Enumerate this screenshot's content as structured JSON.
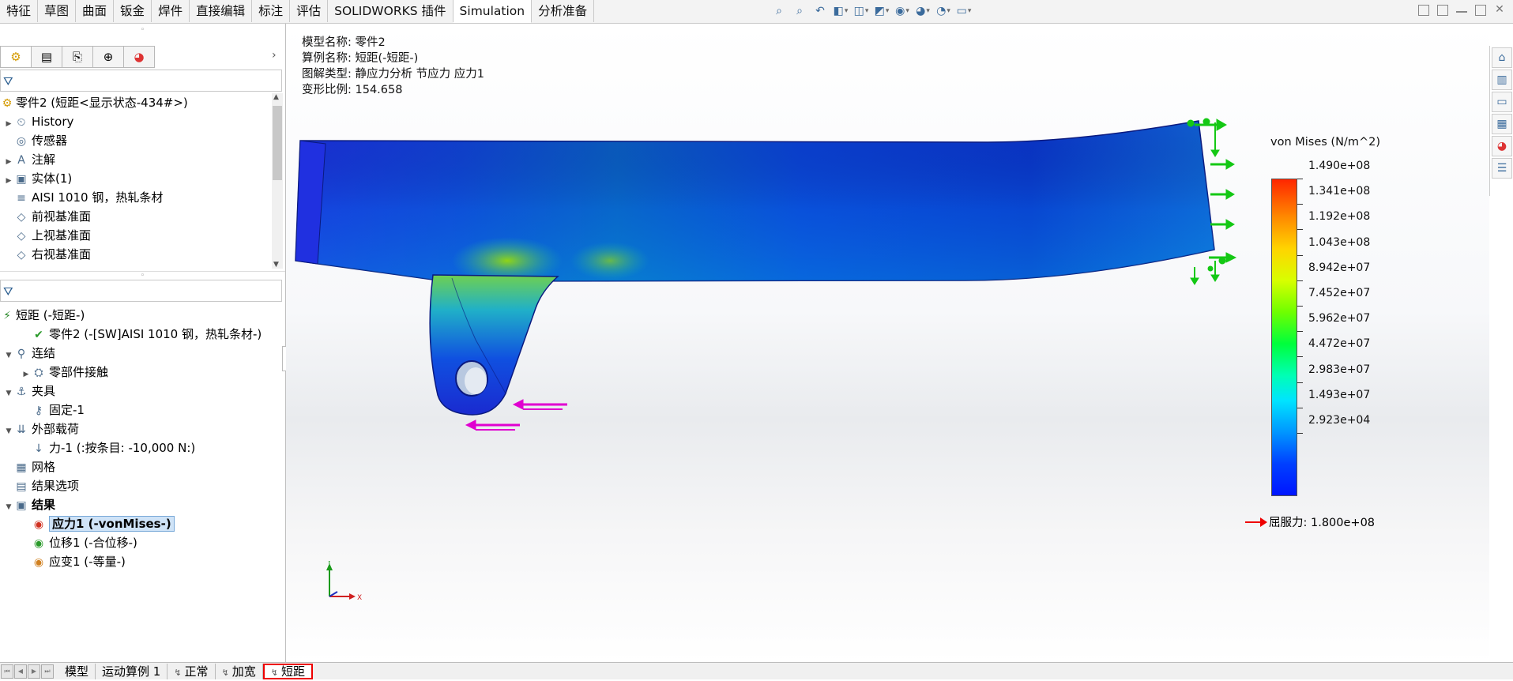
{
  "command_tabs": [
    "特征",
    "草图",
    "曲面",
    "钣金",
    "焊件",
    "直接编辑",
    "标注",
    "评估",
    "SOLIDWORKS 插件",
    "Simulation",
    "分析准备"
  ],
  "active_tab": "Simulation",
  "view_tool_icons": [
    "zoom-to-fit-icon",
    "zoom-area-icon",
    "previous-view-icon",
    "section-view-icon",
    "view-orientation-icon",
    "display-style-icon",
    "hide-show-icon",
    "edit-appearance-icon",
    "apply-scene-icon",
    "view-settings-icon"
  ],
  "feature_tree": {
    "root": "零件2  (短距<显示状态-434#>)",
    "items": [
      {
        "label": "History",
        "icon": "history-icon",
        "expandable": true
      },
      {
        "label": "传感器",
        "icon": "sensor-icon",
        "expandable": false
      },
      {
        "label": "注解",
        "icon": "annotation-icon",
        "expandable": true
      },
      {
        "label": "实体(1)",
        "icon": "solid-body-icon",
        "expandable": true
      },
      {
        "label": "AISI 1010 钢，热轧条材",
        "icon": "material-icon",
        "expandable": false
      },
      {
        "label": "前视基准面",
        "icon": "plane-icon",
        "expandable": false
      },
      {
        "label": "上视基准面",
        "icon": "plane-icon",
        "expandable": false
      },
      {
        "label": "右视基准面",
        "icon": "plane-icon",
        "expandable": false
      }
    ]
  },
  "sim_tree": {
    "root": "短距 (-短距-)",
    "items": [
      {
        "label": "零件2 (-[SW]AISI 1010 钢，热轧条材-)",
        "level": 1,
        "icon": "part-check-icon",
        "expandable": false
      },
      {
        "label": "连结",
        "level": 0,
        "icon": "connection-icon",
        "expandable": true
      },
      {
        "label": "零部件接触",
        "level": 1,
        "icon": "component-contact-icon",
        "expandable": true
      },
      {
        "label": "夹具",
        "level": 0,
        "icon": "fixture-icon",
        "expandable": true
      },
      {
        "label": "固定-1",
        "level": 1,
        "icon": "fixed-geometry-icon",
        "expandable": false
      },
      {
        "label": "外部载荷",
        "level": 0,
        "icon": "external-load-icon",
        "expandable": true
      },
      {
        "label": "力-1 (:按条目: -10,000 N:)",
        "level": 1,
        "icon": "force-arrow-icon",
        "expandable": false
      },
      {
        "label": "网格",
        "level": 0,
        "icon": "mesh-icon",
        "expandable": false
      },
      {
        "label": "结果选项",
        "level": 0,
        "icon": "result-options-icon",
        "expandable": false
      },
      {
        "label": "结果",
        "level": 0,
        "icon": "results-folder-icon",
        "expandable": true,
        "bold": true
      },
      {
        "label": "应力1 (-vonMises-)",
        "level": 1,
        "icon": "stress-plot-icon",
        "expandable": false,
        "selected": true
      },
      {
        "label": "位移1 (-合位移-)",
        "level": 1,
        "icon": "displacement-plot-icon",
        "expandable": false
      },
      {
        "label": "应变1 (-等量-)",
        "level": 1,
        "icon": "strain-plot-icon",
        "expandable": false
      }
    ]
  },
  "plot_info": {
    "lines": [
      "模型名称: 零件2",
      "算例名称: 短距(-短距-)",
      "图解类型: 静应力分析 节应力 应力1",
      "变形比例: 154.658"
    ]
  },
  "legend": {
    "title": "von Mises (N/m^2)",
    "labels": [
      "1.490e+08",
      "1.341e+08",
      "1.192e+08",
      "1.043e+08",
      "8.942e+07",
      "7.452e+07",
      "5.962e+07",
      "4.472e+07",
      "2.983e+07",
      "1.493e+07",
      "2.923e+04"
    ],
    "yield_label": "屈服力: 1.800e+08",
    "yield_color": "#e00000"
  },
  "triad": {
    "x": "X",
    "y": "Y"
  },
  "bottom_tabs": [
    "模型",
    "运动算例 1",
    "正常",
    "加宽",
    "短距"
  ],
  "active_bottom_tab": "短距",
  "colors": {
    "accent": "#3b6b9c",
    "selection": "#cfe3f7",
    "highlight_border": "#e00000"
  }
}
